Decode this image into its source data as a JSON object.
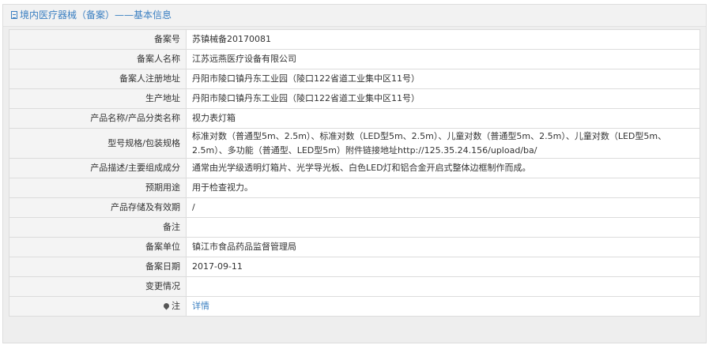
{
  "header": {
    "title": "境内医疗器械（备案）——基本信息",
    "icon": "document-icon"
  },
  "rows": [
    {
      "label": "备案号",
      "value": "苏镇械备20170081"
    },
    {
      "label": "备案人名称",
      "value": "江苏远燕医疗设备有限公司"
    },
    {
      "label": "备案人注册地址",
      "value": "丹阳市陵口镇丹东工业园（陵口122省道工业集中区11号）"
    },
    {
      "label": "生产地址",
      "value": "丹阳市陵口镇丹东工业园（陵口122省道工业集中区11号）"
    },
    {
      "label": "产品名称/产品分类名称",
      "value": "视力表灯箱"
    },
    {
      "label": "型号规格/包装规格",
      "value": "标准对数（普通型5m、2.5m）、标准对数（LED型5m、2.5m）、儿童对数（普通型5m、2.5m）、儿童对数（LED型5m、2.5m）、多功能（普通型、LED型5m）附件链接地址http://125.35.24.156/upload/ba/"
    },
    {
      "label": "产品描述/主要组成成分",
      "value": "通常由光学级透明灯箱片、光学导光板、白色LED灯和铝合金开启式整体边框制作而成。"
    },
    {
      "label": "预期用途",
      "value": "用于检查视力。"
    },
    {
      "label": "产品存储及有效期",
      "value": "/"
    },
    {
      "label": "备注",
      "value": ""
    },
    {
      "label": "备案单位",
      "value": "镇江市食品药品监督管理局"
    },
    {
      "label": "备案日期",
      "value": "2017-09-11"
    },
    {
      "label": "变更情况",
      "value": ""
    },
    {
      "label": "注",
      "value": "详情",
      "icon": "map-pin-icon"
    }
  ],
  "colors": {
    "accent": "#3a7fc1",
    "label_bg": "#f4f4f4",
    "border": "#dcdcdc"
  }
}
